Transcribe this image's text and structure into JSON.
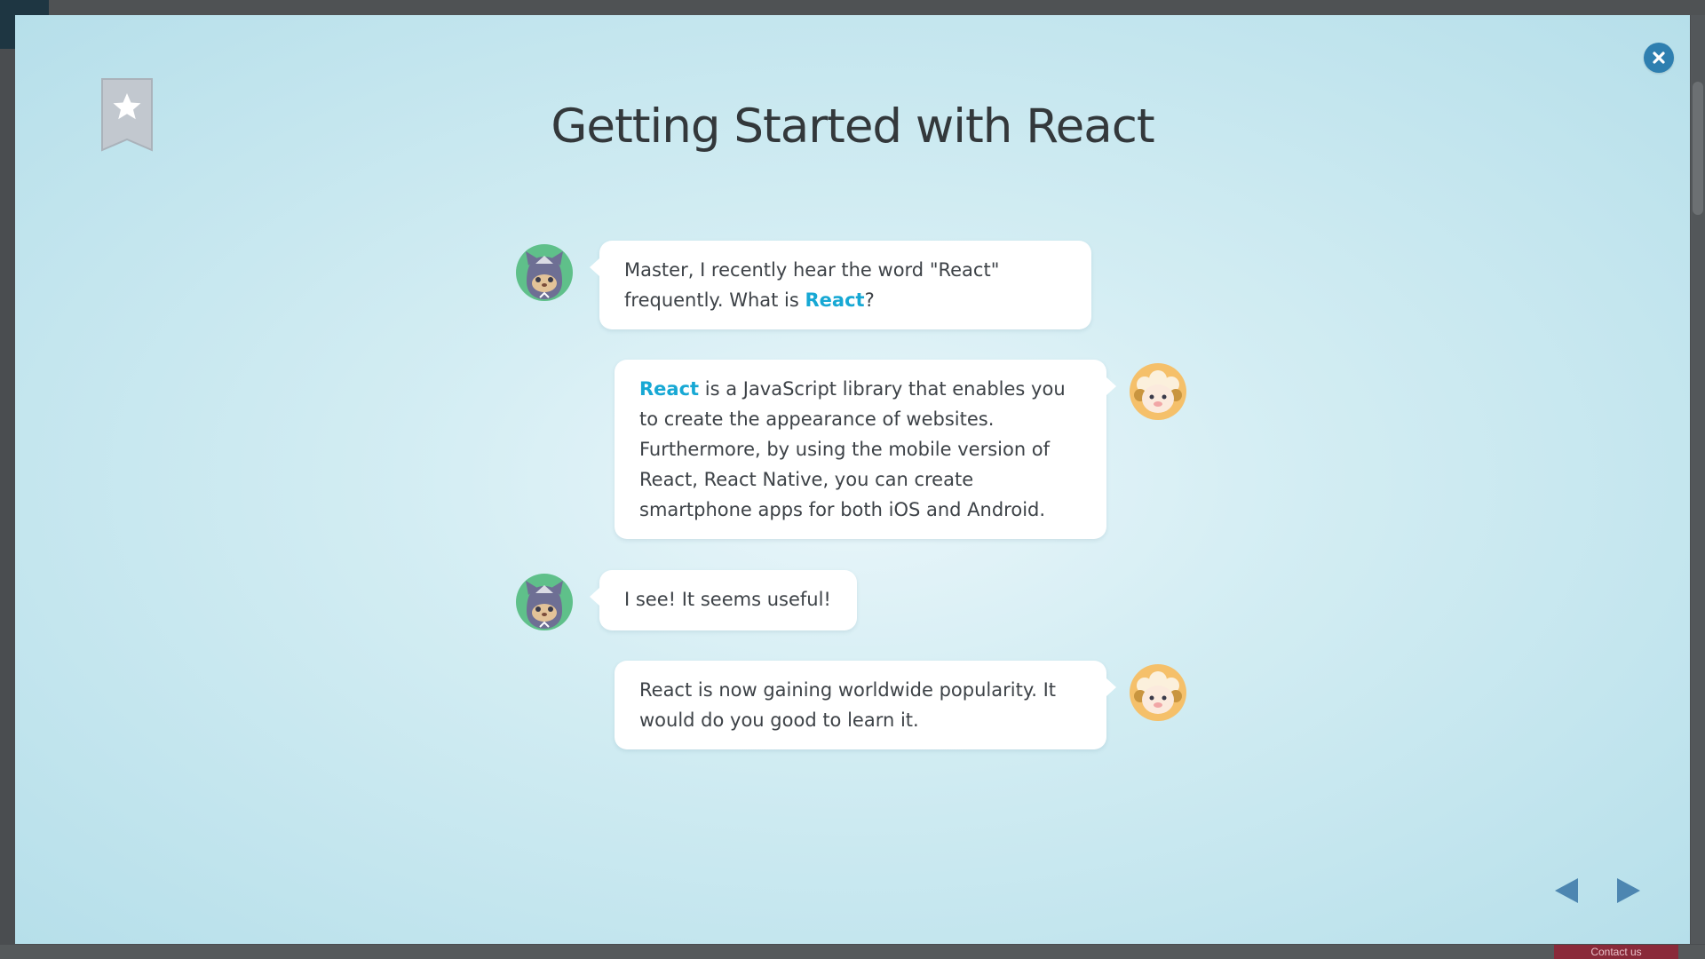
{
  "lesson": {
    "title": "Getting Started with React"
  },
  "messages": [
    {
      "speaker": "student",
      "avatar": "cat-student-avatar",
      "before": "Master, I recently hear the word \"React\" frequently. What is ",
      "highlight": "React",
      "after": "?"
    },
    {
      "speaker": "master",
      "avatar": "sheep-master-avatar",
      "before": "",
      "highlight": "React",
      "after": " is a JavaScript library that enables you to create the appearance of websites. Furthermore, by using the mobile version of React, React Native, you can create smartphone apps for both iOS and Android."
    },
    {
      "speaker": "student",
      "avatar": "cat-student-avatar",
      "text": "I see! It seems useful!"
    },
    {
      "speaker": "master",
      "avatar": "sheep-master-avatar",
      "text": "React is now gaining worldwide popularity. It would do you good to learn it."
    }
  ],
  "background": {
    "contact_label": "Contact us"
  },
  "icons": {
    "close": "close-icon",
    "bookmark": "bookmark-star-icon",
    "prev": "prev-arrow-icon",
    "next": "next-arrow-icon"
  },
  "colors": {
    "accent": "#17a8d4",
    "close_button": "#2e7fb0",
    "nav_arrow": "#4d86b1",
    "title_text": "#33383b",
    "body_text": "#3d4247"
  }
}
